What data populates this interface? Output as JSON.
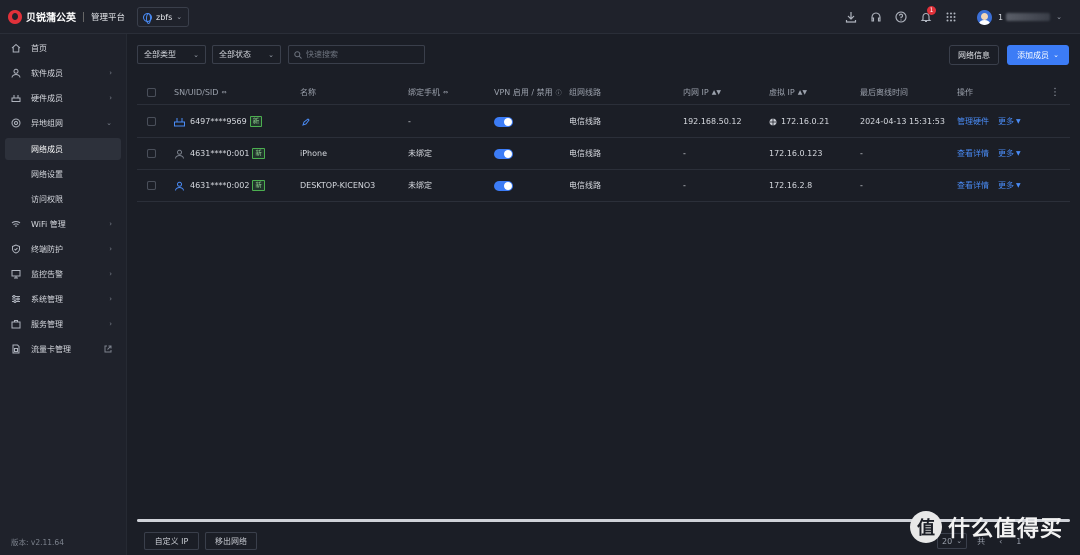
{
  "brand": {
    "name": "贝锐蒲公英",
    "subtitle": "管理平台"
  },
  "network_selector": {
    "value": "zbfs"
  },
  "topbar": {
    "notification_count": "1",
    "user_name": "1"
  },
  "sidebar": {
    "items": [
      {
        "label": "首页",
        "icon": "home-icon"
      },
      {
        "label": "软件成员",
        "icon": "user-icon"
      },
      {
        "label": "硬件成员",
        "icon": "router-icon"
      },
      {
        "label": "异地组网",
        "icon": "network-icon"
      },
      {
        "label": "网络成员"
      },
      {
        "label": "网络设置"
      },
      {
        "label": "访问权限"
      },
      {
        "label": "WiFi 管理",
        "icon": "wifi-icon"
      },
      {
        "label": "终端防护",
        "icon": "shield-icon"
      },
      {
        "label": "监控告警",
        "icon": "monitor-icon"
      },
      {
        "label": "系统管理",
        "icon": "sliders-icon"
      },
      {
        "label": "服务管理",
        "icon": "briefcase-icon"
      },
      {
        "label": "流量卡管理",
        "icon": "sim-card-icon"
      }
    ],
    "version": "版本: v2.11.64"
  },
  "toolbar": {
    "type_filter": "全部类型",
    "status_filter": "全部状态",
    "search_placeholder": "快速搜索",
    "network_info_label": "网络信息",
    "add_member_label": "添加成员"
  },
  "table": {
    "columns": [
      "SN/UID/SID",
      "名称",
      "绑定手机",
      "VPN 启用 / 禁用",
      "组网线路",
      "内网 IP",
      "虚拟 IP",
      "最后离线时间",
      "操作"
    ],
    "rows": [
      {
        "id": "6497****9569",
        "tag": "新",
        "name": "",
        "phone": "-",
        "vpn_enabled": true,
        "line": "电信线路",
        "lan_ip": "192.168.50.12",
        "virtual_ip": "172.16.0.21",
        "last_offline": "2024-04-13 15:31:53",
        "action": "管理硬件",
        "more": "更多"
      },
      {
        "id": "4631****0:001",
        "tag": "新",
        "name": "iPhone",
        "phone": "未绑定",
        "vpn_enabled": true,
        "line": "电信线路",
        "lan_ip": "-",
        "virtual_ip": "172.16.0.123",
        "last_offline": "-",
        "action": "查看详情",
        "more": "更多"
      },
      {
        "id": "4631****0:002",
        "tag": "新",
        "name": "DESKTOP-KICENO3",
        "phone": "未绑定",
        "vpn_enabled": true,
        "line": "电信线路",
        "lan_ip": "-",
        "virtual_ip": "172.16.2.8",
        "last_offline": "-",
        "action": "查看详情",
        "more": "更多"
      }
    ]
  },
  "footer": {
    "custom_ip_label": "自定义 IP",
    "remove_label": "移出网络",
    "page_size": "20",
    "page_prefix": "共",
    "page_nav": "1"
  },
  "watermark": {
    "logo": "值",
    "text": "什么值得买"
  }
}
